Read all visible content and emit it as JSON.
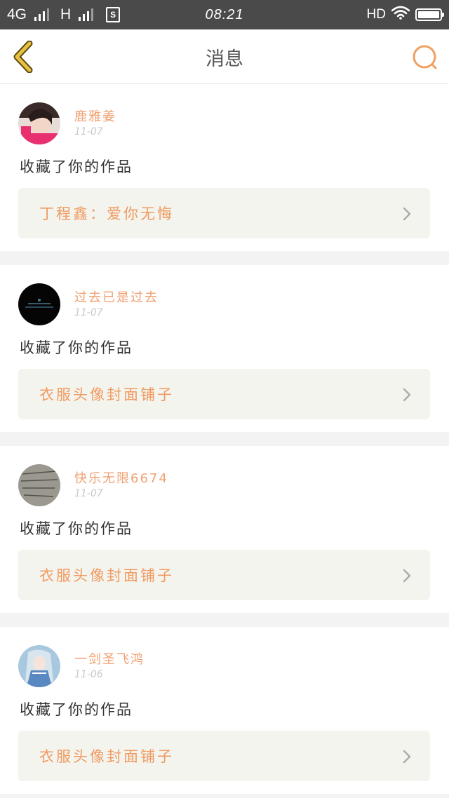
{
  "status_bar": {
    "network_1": "4G",
    "network_2": "H",
    "sim_label": "S",
    "time": "08:21",
    "hd_label": "HD"
  },
  "header": {
    "title": "消息",
    "back_icon": "chevron-left-icon",
    "search_icon": "search-icon"
  },
  "colors": {
    "accent_orange": "#f09a60",
    "back_yellow": "#e8c040",
    "search_orange": "#f0a060"
  },
  "messages": [
    {
      "username": "鹿雅姜",
      "date": "11-07",
      "action": "收藏了你的作品",
      "work_title": "丁程鑫：爱你无悔"
    },
    {
      "username": "过去已是过去",
      "date": "11-07",
      "action": "收藏了你的作品",
      "work_title": "衣服头像封面铺子"
    },
    {
      "username": "快乐无限6674",
      "date": "11-07",
      "action": "收藏了你的作品",
      "work_title": "衣服头像封面铺子"
    },
    {
      "username": "一剑圣飞鸿",
      "date": "11-06",
      "action": "收藏了你的作品",
      "work_title": "衣服头像封面铺子"
    }
  ]
}
